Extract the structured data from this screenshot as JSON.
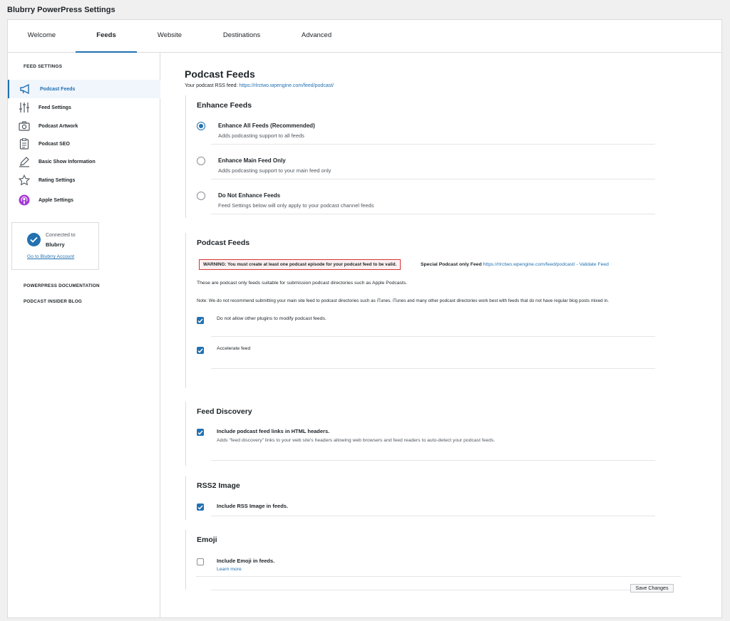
{
  "app": {
    "title": "Blubrry PowerPress Settings"
  },
  "tabs": [
    {
      "label": "Welcome"
    },
    {
      "label": "Feeds"
    },
    {
      "label": "Website"
    },
    {
      "label": "Destinations"
    },
    {
      "label": "Advanced"
    }
  ],
  "sidebar": {
    "heading": "FEED SETTINGS",
    "items": [
      {
        "label": "Podcast Feeds",
        "icon": "megaphone-icon"
      },
      {
        "label": "Feed Settings",
        "icon": "sliders-icon"
      },
      {
        "label": "Podcast Artwork",
        "icon": "camera-icon"
      },
      {
        "label": "Podcast SEO",
        "icon": "clipboard-icon"
      },
      {
        "label": "Basic Show Information",
        "icon": "pencil-icon"
      },
      {
        "label": "Rating Settings",
        "icon": "star-icon"
      },
      {
        "label": "Apple Settings",
        "icon": "apple-podcasts-icon"
      }
    ],
    "account": {
      "line1": "Connected to",
      "line2": "Blubrry",
      "link": "Go to Blubrry Account"
    },
    "links": [
      "POWERPRESS DOCUMENTATION",
      "PODCAST INSIDER BLOG"
    ]
  },
  "main": {
    "title": "Podcast Feeds",
    "rss_label": "Your podcast RSS feed:",
    "rss_url": "https://rlrctwo.wpengine.com/feed/podcast/",
    "enhance": {
      "heading": "Enhance Feeds",
      "options": [
        {
          "title": "Enhance All Feeds (Recommended)",
          "desc": "Adds podcasting support to all feeds",
          "checked": true
        },
        {
          "title": "Enhance Main Feed Only",
          "desc": "Adds podcasting support to your main feed only",
          "checked": false
        },
        {
          "title": "Do Not Enhance Feeds",
          "desc": "Feed Settings below will only apply to your podcast channel feeds",
          "checked": false
        }
      ]
    },
    "podcast_feeds": {
      "heading": "Podcast Feeds",
      "warning": "WARNING: You must create at least one podcast episode for your podcast feed to be valid.",
      "special_label": "Special Podcast only Feed",
      "special_url": "https://rlrctwo.wpengine.com/feed/podcast/",
      "validate": "- Validate Feed",
      "desc": "These are podcast only feeds suitable for submission podcast directories such as Apple Podcasts.",
      "note": "Note: We do not recommend submitting your main site feed to podcast directories such as iTunes. iTunes and many other podcast directories work best with feeds that do not have regular blog posts mixed in.",
      "checkboxes": [
        {
          "label": "Do not allow other plugins to modify podcast feeds.",
          "checked": true
        },
        {
          "label": "Accelerate feed",
          "checked": true
        }
      ]
    },
    "discovery": {
      "heading": "Feed Discovery",
      "label": "Include podcast feed links in HTML headers.",
      "desc": "Adds \"feed discovery\" links to your web site's headers allowing web browsers and feed readers to auto-detect your podcast feeds.",
      "checked": true
    },
    "rss2": {
      "heading": "RSS2 Image",
      "label": "Include RSS Image in feeds.",
      "checked": true
    },
    "emoji": {
      "heading": "Emoji",
      "label": "Include Emoji in feeds.",
      "learn_more": "Learn more",
      "checked": false
    },
    "save_label": "Save Changes"
  },
  "colors": {
    "accent": "#2271b1",
    "warning_border": "#d63638"
  }
}
